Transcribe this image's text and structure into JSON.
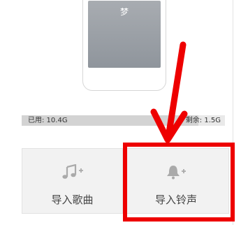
{
  "phone": {
    "screen_text": "梦"
  },
  "storage": {
    "used_label": "已用: 10.4G",
    "free_label": "剩余: 1.5G",
    "used_fraction": 0.87
  },
  "tiles": [
    {
      "label": "导入歌曲",
      "icon": "music-note-add-icon"
    },
    {
      "label": "导入铃声",
      "icon": "bell-add-icon"
    }
  ],
  "colors": {
    "annotation": "#ee0000",
    "tile_bg": "#f2f2f2",
    "icon": "#aaaaaa"
  }
}
